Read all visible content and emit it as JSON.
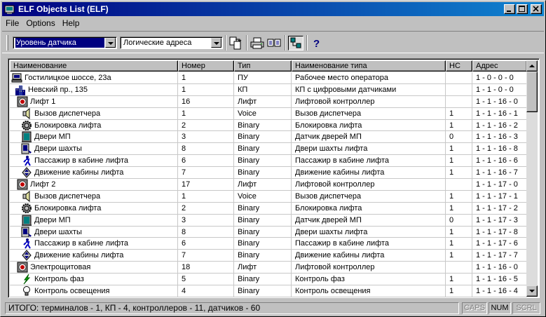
{
  "window": {
    "title": "ELF Objects List (ELF)"
  },
  "menu": [
    "File",
    "Options",
    "Help"
  ],
  "toolbar": {
    "combo1": "Уровень датчика",
    "combo2": "Логические адреса"
  },
  "columns": [
    "Наименование",
    "Номер",
    "Тип",
    "Наименование типа",
    "НС",
    "Адрес"
  ],
  "rows": [
    {
      "indent": 0,
      "icon": "computer-icon",
      "name": "Гостилицкое шоссе, 23а",
      "num": "1",
      "type": "ПУ",
      "type_name": "Рабочее место оператора",
      "ns": "",
      "addr": "1 - 0 - 0 - 0"
    },
    {
      "indent": 1,
      "icon": "building-icon",
      "name": "Невский пр., 135",
      "num": "1",
      "type": "КП",
      "type_name": "КП с цифровыми датчиками",
      "ns": "",
      "addr": "1 - 1 - 0 - 0"
    },
    {
      "indent": 2,
      "icon": "elevator-controller-icon",
      "name": "Лифт 1",
      "num": "16",
      "type": "Лифт",
      "type_name": "Лифтовой контроллер",
      "ns": "",
      "addr": "1 - 1 - 16 - 0"
    },
    {
      "indent": 3,
      "icon": "speaker-icon",
      "name": "Вызов диспетчера",
      "num": "1",
      "type": "Voice",
      "type_name": "Вызов диспетчера",
      "ns": "1",
      "addr": "1 - 1 - 16 - 1"
    },
    {
      "indent": 3,
      "icon": "gear-icon",
      "name": "Блокировка лифта",
      "num": "2",
      "type": "Binary",
      "type_name": "Блокировка лифта",
      "ns": "1",
      "addr": "1 - 1 - 16 - 2"
    },
    {
      "indent": 3,
      "icon": "door-icon",
      "name": "Двери МП",
      "num": "3",
      "type": "Binary",
      "type_name": "Датчик дверей МП",
      "ns": "0",
      "addr": "1 - 1 - 16 - 3"
    },
    {
      "indent": 3,
      "icon": "shaft-door-icon",
      "name": "Двери шахты",
      "num": "8",
      "type": "Binary",
      "type_name": "Двери шахты лифта",
      "ns": "1",
      "addr": "1 - 1 - 16 - 8"
    },
    {
      "indent": 3,
      "icon": "person-icon",
      "name": "Пассажир в кабине лифта",
      "num": "6",
      "type": "Binary",
      "type_name": "Пассажир в кабине лифта",
      "ns": "1",
      "addr": "1 - 1 - 16 - 6"
    },
    {
      "indent": 3,
      "icon": "up-down-icon",
      "name": "Движение кабины лифта",
      "num": "7",
      "type": "Binary",
      "type_name": "Движение кабины лифта",
      "ns": "1",
      "addr": "1 - 1 - 16 - 7"
    },
    {
      "indent": 2,
      "icon": "elevator-controller-icon",
      "name": "Лифт 2",
      "num": "17",
      "type": "Лифт",
      "type_name": "Лифтовой контроллер",
      "ns": "",
      "addr": "1 - 1 - 17 - 0"
    },
    {
      "indent": 3,
      "icon": "speaker-icon",
      "name": "Вызов диспетчера",
      "num": "1",
      "type": "Voice",
      "type_name": "Вызов диспетчера",
      "ns": "1",
      "addr": "1 - 1 - 17 - 1"
    },
    {
      "indent": 3,
      "icon": "gear-icon",
      "name": "Блокировка лифта",
      "num": "2",
      "type": "Binary",
      "type_name": "Блокировка лифта",
      "ns": "1",
      "addr": "1 - 1 - 17 - 2"
    },
    {
      "indent": 3,
      "icon": "door-icon",
      "name": "Двери МП",
      "num": "3",
      "type": "Binary",
      "type_name": "Датчик дверей МП",
      "ns": "0",
      "addr": "1 - 1 - 17 - 3"
    },
    {
      "indent": 3,
      "icon": "shaft-door-icon",
      "name": "Двери шахты",
      "num": "8",
      "type": "Binary",
      "type_name": "Двери шахты лифта",
      "ns": "1",
      "addr": "1 - 1 - 17 - 8"
    },
    {
      "indent": 3,
      "icon": "person-icon",
      "name": "Пассажир в кабине лифта",
      "num": "6",
      "type": "Binary",
      "type_name": "Пассажир в кабине лифта",
      "ns": "1",
      "addr": "1 - 1 - 17 - 6"
    },
    {
      "indent": 3,
      "icon": "up-down-icon",
      "name": "Движение кабины лифта",
      "num": "7",
      "type": "Binary",
      "type_name": "Движение кабины лифта",
      "ns": "1",
      "addr": "1 - 1 - 17 - 7"
    },
    {
      "indent": 2,
      "icon": "elevator-controller-icon",
      "name": "Электрощитовая",
      "num": "18",
      "type": "Лифт",
      "type_name": "Лифтовой контроллер",
      "ns": "",
      "addr": "1 - 1 - 16 - 0"
    },
    {
      "indent": 3,
      "icon": "lightning-icon",
      "name": "Контроль фаз",
      "num": "5",
      "type": "Binary",
      "type_name": "Контроль фаз",
      "ns": "1",
      "addr": "1 - 1 - 16 - 5"
    },
    {
      "indent": 3,
      "icon": "lamp-icon",
      "name": "Контроль освещения",
      "num": "4",
      "type": "Binary",
      "type_name": "Контроль освещения",
      "ns": "1",
      "addr": "1 - 1 - 16 - 4"
    }
  ],
  "status": {
    "summary": "ИТОГО: терминалов - 1, КП - 4, контроллеров - 11, датчиков - 60",
    "caps": "CAPS",
    "num": "NUM",
    "scrl": "SCRL"
  }
}
